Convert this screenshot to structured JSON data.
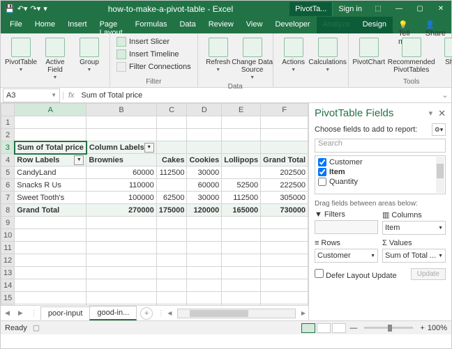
{
  "title": "how-to-make-a-pivot-table - Excel",
  "context_tab": "PivotTa...",
  "signin": "Sign in",
  "menu": [
    "File",
    "Home",
    "Insert",
    "Page Layout",
    "Formulas",
    "Data",
    "Review",
    "View",
    "Developer",
    "Analyze",
    "Design"
  ],
  "tellme": "Tell me",
  "share": "Share",
  "ribbon": {
    "pivottable": "PivotTable",
    "activefield": "Active\nField",
    "group": "Group",
    "slicer": "Insert Slicer",
    "timeline": "Insert Timeline",
    "filterconn": "Filter Connections",
    "filter_grp": "Filter",
    "refresh": "Refresh",
    "changedata": "Change Data\nSource",
    "data_grp": "Data",
    "actions": "Actions",
    "calcs": "Calculations",
    "pivotchart": "PivotChart",
    "recommended": "Recommended\nPivotTables",
    "show": "Show",
    "tools_grp": "Tools"
  },
  "namebox": "A3",
  "formula": "Sum of Total price",
  "cols": [
    "A",
    "B",
    "C",
    "D",
    "E",
    "F"
  ],
  "pivot": {
    "r3a": "Sum of Total price",
    "r3b": "Column Labels",
    "r4": [
      "Row Labels",
      "Brownies",
      "Cakes",
      "Cookies",
      "Lollipops",
      "Grand Total"
    ],
    "r5": [
      "CandyLand",
      "60000",
      "112500",
      "30000",
      "",
      "202500"
    ],
    "r6": [
      "Snacks R Us",
      "110000",
      "",
      "60000",
      "52500",
      "222500"
    ],
    "r7": [
      "Sweet Tooth's",
      "100000",
      "62500",
      "30000",
      "112500",
      "305000"
    ],
    "r8": [
      "Grand Total",
      "270000",
      "175000",
      "120000",
      "165000",
      "730000"
    ]
  },
  "tabs": {
    "t1": "poor-input",
    "t2": "good-in..."
  },
  "pane": {
    "title": "PivotTable Fields",
    "sub": "Choose fields to add to report:",
    "search": "Search",
    "f0": "Customer",
    "f1": "Item",
    "f2": "Quantity",
    "drag": "Drag fields between areas below:",
    "filters": "Filters",
    "columns": "Columns",
    "rows": "Rows",
    "values": "Values",
    "col_val": "Item",
    "row_val": "Customer",
    "val_val": "Sum of Total ...",
    "defer": "Defer Layout Update",
    "update": "Update"
  },
  "status": {
    "ready": "Ready",
    "zoom": "100%"
  }
}
